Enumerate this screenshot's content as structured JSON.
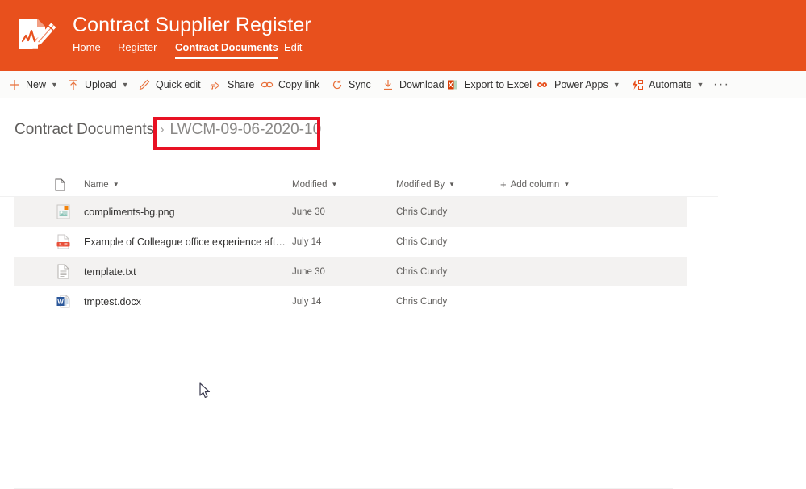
{
  "header": {
    "title": "Contract Supplier Register",
    "logo_icon": "document-signature-pencil-icon",
    "brand_color": "#e8501d",
    "nav": [
      {
        "label": "Home",
        "active": false
      },
      {
        "label": "Register",
        "active": false
      },
      {
        "label": "Contract Documents",
        "active": true
      },
      {
        "label": "Edit",
        "active": false
      }
    ]
  },
  "command_bar": {
    "items": [
      {
        "label": "New",
        "icon": "plus-icon",
        "has_chevron": true
      },
      {
        "label": "Upload",
        "icon": "upload-arrow-icon",
        "has_chevron": true
      },
      {
        "label": "Quick edit",
        "icon": "pencil-icon",
        "has_chevron": false
      },
      {
        "label": "Share",
        "icon": "share-icon",
        "has_chevron": false
      },
      {
        "label": "Copy link",
        "icon": "link-icon",
        "has_chevron": false
      },
      {
        "label": "Sync",
        "icon": "sync-icon",
        "has_chevron": false
      },
      {
        "label": "Download",
        "icon": "download-icon",
        "has_chevron": false
      },
      {
        "label": "Export to Excel",
        "icon": "excel-icon",
        "has_chevron": false
      },
      {
        "label": "Power Apps",
        "icon": "power-apps-icon",
        "has_chevron": true
      },
      {
        "label": "Automate",
        "icon": "automate-icon",
        "has_chevron": true
      }
    ],
    "overflow_label": "···"
  },
  "breadcrumb": {
    "parent": "Contract Documents",
    "separator": "›",
    "current": "LWCM-09-06-2020-10",
    "highlight_color": "#e81123"
  },
  "file_list": {
    "columns": {
      "type_icon": "file-type-icon",
      "name": "Name",
      "modified": "Modified",
      "modified_by": "Modified By",
      "add_column": "Add column"
    },
    "rows": [
      {
        "name": "compliments-bg.png",
        "modified": "June 30",
        "modified_by": "Chris Cundy",
        "icon": "png-image-file-icon"
      },
      {
        "name": "Example of Colleague office experience afte…",
        "modified": "July 14",
        "modified_by": "Chris Cundy",
        "icon": "pdf-file-icon"
      },
      {
        "name": "template.txt",
        "modified": "June 30",
        "modified_by": "Chris Cundy",
        "icon": "txt-file-icon"
      },
      {
        "name": "tmptest.docx",
        "modified": "July 14",
        "modified_by": "Chris Cundy",
        "icon": "word-file-icon"
      }
    ]
  },
  "cursor": {
    "icon": "mouse-pointer-icon"
  }
}
